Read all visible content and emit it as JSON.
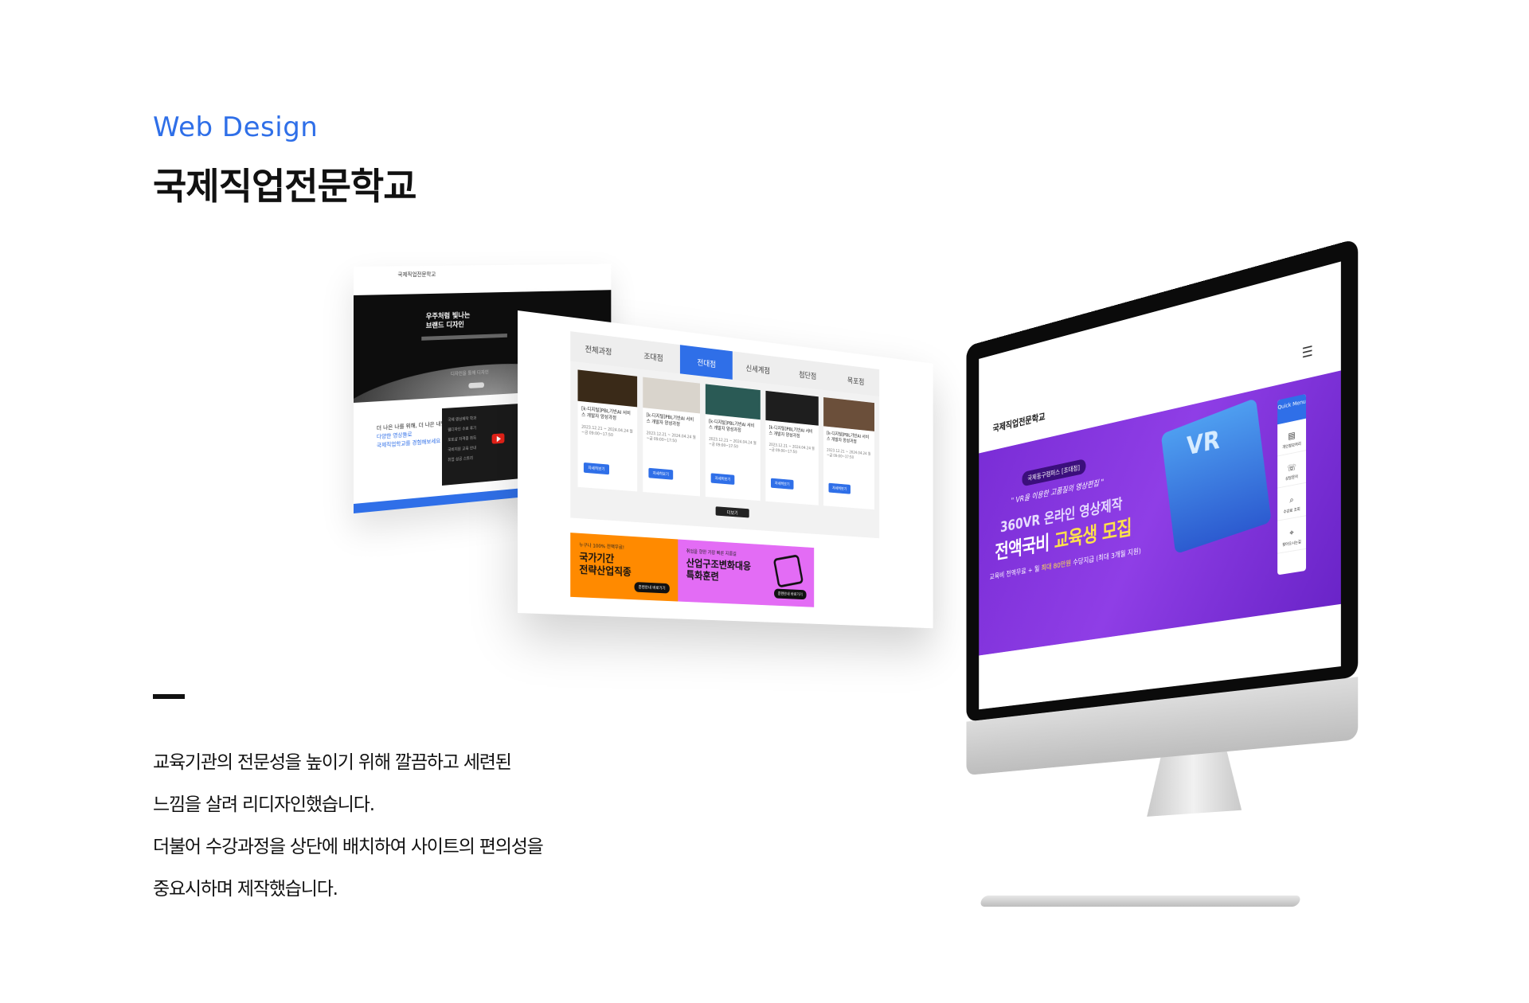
{
  "header": {
    "eyebrow": "Web Design",
    "title": "국제직업전문학교"
  },
  "description": [
    "교육기관의 전문성을 높이기 위해 깔끔하고 세련된",
    "느낌을 살려 리디자인했습니다.",
    "더불어 수강과정을 상단에 배치하여 사이트의 편의성을",
    "중요시하며 제작했습니다."
  ],
  "card_back": {
    "logo": "국제직업전문학교",
    "hero_title_1": "우주처럼 빛나는",
    "hero_title_2": "브랜드 디자인",
    "hero_caption": "디자인을 통해 디자인",
    "text_1": "더 나은 나를 위해, 더 나은 내일을 위해",
    "text_2": "다양한 영상들로",
    "text_3": "국제직업학교를 경험해보세요",
    "video_items": [
      "국제 영상제작 학과",
      "웹디자인 수료 후기",
      "포토샵 자격증 취득",
      "국비지원 교육 안내",
      "취업 성공 스토리"
    ]
  },
  "card_mid": {
    "tabs": [
      {
        "label": "전체과정",
        "active": false
      },
      {
        "label": "조대점",
        "active": false
      },
      {
        "label": "전대점",
        "active": true
      },
      {
        "label": "신세계점",
        "active": false
      },
      {
        "label": "첨단점",
        "active": false
      },
      {
        "label": "목포점",
        "active": false
      }
    ],
    "courses": [
      {
        "name": "[k-디지털]PBL기반AI 서비스 개발자 양성과정",
        "date": "2023.12.21 ~ 2024.04.24 월~금 09:00~17:50",
        "button": "자세히보기",
        "thumb_color": "#3a2a18"
      },
      {
        "name": "[k-디지털]PBL기반AI 서비스 개발자 양성과정",
        "date": "2023.12.21 ~ 2024.04.24 월~금 09:00~17:50",
        "button": "자세히보기",
        "thumb_color": "#d9d4cc"
      },
      {
        "name": "[k-디지털]PBL기반AI 서비스 개발자 양성과정",
        "date": "2023.12.21 ~ 2024.04.24 월~금 09:00~17:50",
        "button": "자세히보기",
        "thumb_color": "#2a5a55"
      },
      {
        "name": "[k-디지털]PBL기반AI 서비스 개발자 양성과정",
        "date": "2023.12.21 ~ 2024.04.24 월~금 09:00~17:50",
        "button": "자세히보기",
        "thumb_color": "#1e1e1e"
      },
      {
        "name": "[k-디지털]PBL기반AI 서비스 개발자 양성과정",
        "date": "2023.12.21 ~ 2024.04.24 월~금 09:00~17:50",
        "button": "자세히보기",
        "thumb_color": "#6b4f3a"
      }
    ],
    "more_button": "더보기",
    "banner_orange": {
      "small": "누구나 100% 전액무료!",
      "big_1": "국가기간",
      "big_2": "전략산업직종",
      "pill": "훈련안내 바로가기"
    },
    "banner_pink": {
      "small": "취업을 향한 가장 빠른 지름길",
      "big_1": "산업구조변화대응",
      "big_2": "특화훈련",
      "pill": "훈련안내 바로가기"
    }
  },
  "monitor_site": {
    "logo": "국제직업전문학교",
    "hamburger": "☰",
    "hero_badge": "국제동구캠퍼스 [조대점]",
    "hero_quote": "\" VR을 이용한 고품질의 영상편집 \"",
    "hero_line1": "360VR 온라인 영상제작",
    "hero_line2_a": "전액국비 ",
    "hero_line2_b": "교육생 모집",
    "hero_line3_a": "교육비 전액무료 + 월 ",
    "hero_line3_b": "최대 80만원",
    "hero_line3_c": " 수당지급",
    "hero_line3_d": "(최대 3개월 지원)",
    "vr_text": "VR",
    "quick_menu_title": "Quick Menu",
    "quick_menu_items": [
      {
        "icon": "▤",
        "label": "개인정보처리"
      },
      {
        "icon": "☏",
        "label": "상담문의"
      },
      {
        "icon": "⌕",
        "label": "수강료 조회"
      },
      {
        "icon": "⌖",
        "label": "찾아오시는길"
      }
    ],
    "colors": {
      "hero": "#8a38e0",
      "accent": "#2f6fe8",
      "highlight": "#ffe24a"
    }
  }
}
